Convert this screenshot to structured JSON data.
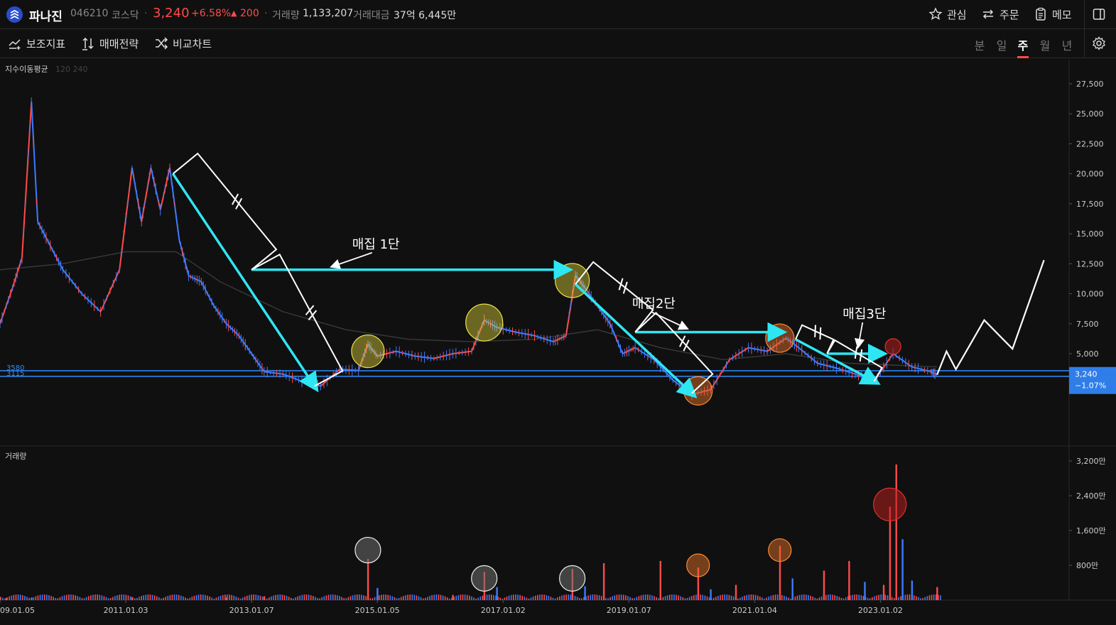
{
  "header": {
    "name": "파나진",
    "code": "046210",
    "market": "코스닥",
    "price": "3,240",
    "change_pct": "+6.58%",
    "change_arrow": "▲",
    "change_val": "200",
    "volume_label": "거래량",
    "volume_value": "1,133,207",
    "amount_label": "거래대금",
    "amount_value": "37억 6,445만",
    "buttons": {
      "watch": "관심",
      "order": "주문",
      "memo": "메모"
    }
  },
  "toolbar": {
    "indicators": "보조지표",
    "strategy": "매매전략",
    "compare": "비교차트",
    "periods": [
      "분",
      "일",
      "주",
      "월",
      "년"
    ],
    "active_period": "주"
  },
  "colors": {
    "background": "#101010",
    "up": "#ff4b4b",
    "down": "#3d7bff",
    "cyan_arrow": "#2ee6f2",
    "level_line": "#2f8cff"
  },
  "chart_data": [
    {
      "type": "line",
      "name": "price-chart",
      "legend_label": "지수이동평균",
      "legend_params": "120 240",
      "y_ticks": [
        "27,500",
        "25,000",
        "22,500",
        "20,000",
        "17,500",
        "15,000",
        "12,500",
        "10,000",
        "7,500",
        "5,000"
      ],
      "y_tick_values": [
        27500,
        25000,
        22500,
        20000,
        17500,
        15000,
        12500,
        10000,
        7500,
        5000
      ],
      "ylim": [
        -2800,
        28500
      ],
      "x_ticks": [
        "09.01.05",
        "2011.01.03",
        "2013.01.07",
        "2015.01.05",
        "2017.01.02",
        "2019.01.07",
        "2021.01.04",
        "2023.01.02"
      ],
      "x_tick_values": [
        2009.0,
        2011.0,
        2013.0,
        2015.0,
        2017.0,
        2019.0,
        2021.0,
        2023.0
      ],
      "xlim": [
        2009.0,
        2026.0
      ],
      "price_points": [
        {
          "x": 2009.0,
          "y": 7500
        },
        {
          "x": 2009.2,
          "y": 10500
        },
        {
          "x": 2009.35,
          "y": 13000
        },
        {
          "x": 2009.5,
          "y": 26000
        },
        {
          "x": 2009.6,
          "y": 16000
        },
        {
          "x": 2009.8,
          "y": 14000
        },
        {
          "x": 2010.0,
          "y": 12000
        },
        {
          "x": 2010.3,
          "y": 10000
        },
        {
          "x": 2010.6,
          "y": 8500
        },
        {
          "x": 2010.9,
          "y": 12000
        },
        {
          "x": 2011.1,
          "y": 20500
        },
        {
          "x": 2011.25,
          "y": 16000
        },
        {
          "x": 2011.4,
          "y": 20500
        },
        {
          "x": 2011.55,
          "y": 17000
        },
        {
          "x": 2011.7,
          "y": 20500
        },
        {
          "x": 2011.85,
          "y": 14500
        },
        {
          "x": 2012.0,
          "y": 11500
        },
        {
          "x": 2012.2,
          "y": 11000
        },
        {
          "x": 2012.4,
          "y": 9000
        },
        {
          "x": 2012.6,
          "y": 7500
        },
        {
          "x": 2012.8,
          "y": 6500
        },
        {
          "x": 2013.0,
          "y": 5000
        },
        {
          "x": 2013.2,
          "y": 3500
        },
        {
          "x": 2013.5,
          "y": 3300
        },
        {
          "x": 2013.8,
          "y": 2700
        },
        {
          "x": 2014.1,
          "y": 2300
        },
        {
          "x": 2014.4,
          "y": 3700
        },
        {
          "x": 2014.7,
          "y": 3600
        },
        {
          "x": 2014.85,
          "y": 5800
        },
        {
          "x": 2015.0,
          "y": 4800
        },
        {
          "x": 2015.3,
          "y": 5200
        },
        {
          "x": 2015.6,
          "y": 4800
        },
        {
          "x": 2015.9,
          "y": 4600
        },
        {
          "x": 2016.2,
          "y": 5000
        },
        {
          "x": 2016.5,
          "y": 5200
        },
        {
          "x": 2016.7,
          "y": 7800
        },
        {
          "x": 2016.9,
          "y": 7200
        },
        {
          "x": 2017.2,
          "y": 6800
        },
        {
          "x": 2017.5,
          "y": 6500
        },
        {
          "x": 2017.8,
          "y": 6000
        },
        {
          "x": 2018.0,
          "y": 6500
        },
        {
          "x": 2018.15,
          "y": 11500
        },
        {
          "x": 2018.3,
          "y": 10500
        },
        {
          "x": 2018.5,
          "y": 9000
        },
        {
          "x": 2018.7,
          "y": 7500
        },
        {
          "x": 2018.9,
          "y": 5000
        },
        {
          "x": 2019.1,
          "y": 5500
        },
        {
          "x": 2019.4,
          "y": 4500
        },
        {
          "x": 2019.7,
          "y": 2800
        },
        {
          "x": 2020.0,
          "y": 1600
        },
        {
          "x": 2020.3,
          "y": 2000
        },
        {
          "x": 2020.6,
          "y": 4500
        },
        {
          "x": 2020.9,
          "y": 5500
        },
        {
          "x": 2021.2,
          "y": 5200
        },
        {
          "x": 2021.5,
          "y": 6300
        },
        {
          "x": 2021.7,
          "y": 5500
        },
        {
          "x": 2022.0,
          "y": 4200
        },
        {
          "x": 2022.3,
          "y": 3800
        },
        {
          "x": 2022.6,
          "y": 3300
        },
        {
          "x": 2022.9,
          "y": 2700
        },
        {
          "x": 2023.2,
          "y": 5000
        },
        {
          "x": 2023.5,
          "y": 3900
        },
        {
          "x": 2023.8,
          "y": 3500
        },
        {
          "x": 2023.9,
          "y": 3240
        }
      ],
      "ema_points": [
        {
          "x": 2009.0,
          "y": 12000
        },
        {
          "x": 2010.0,
          "y": 12500
        },
        {
          "x": 2011.0,
          "y": 13500
        },
        {
          "x": 2011.8,
          "y": 13500
        },
        {
          "x": 2012.5,
          "y": 11000
        },
        {
          "x": 2013.5,
          "y": 8500
        },
        {
          "x": 2014.5,
          "y": 7000
        },
        {
          "x": 2015.5,
          "y": 6200
        },
        {
          "x": 2016.5,
          "y": 6000
        },
        {
          "x": 2017.5,
          "y": 6200
        },
        {
          "x": 2018.5,
          "y": 7000
        },
        {
          "x": 2019.5,
          "y": 5500
        },
        {
          "x": 2020.5,
          "y": 4500
        },
        {
          "x": 2021.5,
          "y": 5000
        },
        {
          "x": 2022.5,
          "y": 4200
        },
        {
          "x": 2023.9,
          "y": 3900
        }
      ],
      "price_levels": [
        {
          "label": "3580",
          "value": 3580
        },
        {
          "label": "3115",
          "value": 3115
        }
      ],
      "current_price": {
        "label": "3,240",
        "change": "−1.07%",
        "value": 3240
      },
      "annotations": [
        "매집 1단",
        "매집2단",
        "매집3단"
      ],
      "trend_arrows": [
        {
          "from": [
            2011.75,
            20000
          ],
          "to": [
            2014.0,
            2300
          ]
        },
        {
          "from": [
            2013.0,
            12000
          ],
          "to": [
            2018.0,
            12000
          ]
        },
        {
          "from": [
            2018.15,
            10800
          ],
          "to": [
            2020.0,
            1700
          ]
        },
        {
          "from": [
            2019.1,
            6800
          ],
          "to": [
            2021.4,
            6800
          ]
        },
        {
          "from": [
            2021.65,
            6200
          ],
          "to": [
            2022.9,
            2700
          ]
        },
        {
          "from": [
            2022.15,
            5000
          ],
          "to": [
            2023.0,
            5000
          ]
        }
      ],
      "projection": [
        {
          "x": 2023.9,
          "y": 3240
        },
        {
          "x": 2024.05,
          "y": 5200
        },
        {
          "x": 2024.2,
          "y": 3700
        },
        {
          "x": 2024.65,
          "y": 7800
        },
        {
          "x": 2025.1,
          "y": 5400
        },
        {
          "x": 2025.6,
          "y": 12800
        }
      ],
      "highlight_circles": [
        {
          "x": 2014.85,
          "y": 5200,
          "color": "yellow"
        },
        {
          "x": 2016.7,
          "y": 7600,
          "color": "yellow"
        },
        {
          "x": 2018.1,
          "y": 11100,
          "color": "yellow"
        },
        {
          "x": 2020.1,
          "y": 1900,
          "color": "orange"
        },
        {
          "x": 2021.4,
          "y": 6300,
          "color": "orange"
        },
        {
          "x": 2023.2,
          "y": 5600,
          "color": "red"
        }
      ]
    },
    {
      "type": "bar",
      "name": "volume-chart",
      "legend_label": "거래량",
      "y_ticks": [
        "3,200만",
        "2,400만",
        "1,600만",
        "800만"
      ],
      "y_tick_values": [
        3200,
        2400,
        1600,
        800
      ],
      "ylim": [
        0,
        3500
      ],
      "unit": "만",
      "x": [
        2009.1,
        2009.5,
        2011.1,
        2012.6,
        2013.2,
        2014.85,
        2015.0,
        2016.2,
        2016.7,
        2016.9,
        2018.1,
        2018.3,
        2018.6,
        2019.5,
        2020.1,
        2020.3,
        2020.7,
        2021.4,
        2021.6,
        2022.1,
        2022.5,
        2022.75,
        2023.05,
        2023.15,
        2023.25,
        2023.35,
        2023.5,
        2023.9
      ],
      "values": [
        50,
        60,
        70,
        60,
        90,
        950,
        280,
        120,
        650,
        300,
        720,
        320,
        850,
        900,
        750,
        250,
        350,
        1250,
        500,
        680,
        900,
        420,
        350,
        2150,
        3120,
        1400,
        450,
        300
      ],
      "directions": [
        "up",
        "down",
        "up",
        "up",
        "up",
        "up",
        "down",
        "up",
        "up",
        "down",
        "up",
        "down",
        "up",
        "up",
        "up",
        "down",
        "up",
        "up",
        "down",
        "up",
        "up",
        "down",
        "up",
        "up",
        "up",
        "down",
        "down",
        "up"
      ],
      "highlight_circles": [
        {
          "x": 2014.85,
          "y": 1150,
          "color": "white"
        },
        {
          "x": 2016.7,
          "y": 500,
          "color": "white"
        },
        {
          "x": 2018.1,
          "y": 500,
          "color": "white"
        },
        {
          "x": 2020.1,
          "y": 800,
          "color": "orange"
        },
        {
          "x": 2021.4,
          "y": 1150,
          "color": "orange"
        },
        {
          "x": 2023.15,
          "y": 2200,
          "color": "red"
        }
      ]
    }
  ]
}
